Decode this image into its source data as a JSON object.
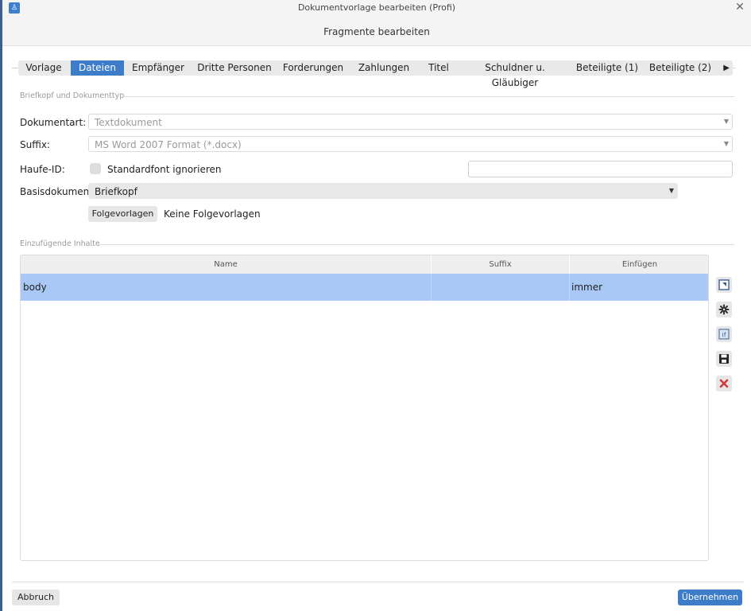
{
  "window": {
    "title": "Dokumentvorlage bearbeiten (Profi)",
    "subtitle": "Fragmente bearbeiten",
    "app_icon": "app-icon",
    "close_glyph": "✕"
  },
  "tabs": {
    "items": [
      "Vorlage",
      "Dateien",
      "Empfänger",
      "Dritte Personen",
      "Forderungen",
      "Zahlungen",
      "Titel",
      "Schuldner u. Gläubiger",
      "Beteiligte (1)",
      "Beteiligte (2)"
    ],
    "active": "Dateien",
    "more_glyph": "▶"
  },
  "briefkopf": {
    "section_title": "Briefkopf und Dokumenttyp",
    "dokumentart_label": "Dokumentart:",
    "dokumentart_value": "Textdokument",
    "suffix_label": "Suffix:",
    "suffix_value": "MS Word 2007 Format (*.docx)",
    "haufe_label": "Haufe-ID:",
    "standardfont_label": "Standardfont ignorieren",
    "standardfont_checked": false,
    "haufe_value": "",
    "basis_label": "Basisdokument:",
    "basis_value": "Briefkopf",
    "folgevorlagen_button": "Folgevorlagen",
    "folgevorlagen_text": "Keine Folgevorlagen"
  },
  "inhalte": {
    "section_title": "Einzufügende Inhalte",
    "columns": [
      "Name",
      "Suffix",
      "Einfügen"
    ],
    "rows": [
      {
        "name": "body",
        "suffix": "",
        "einfuegen": "immer"
      }
    ],
    "tools": [
      "edit-icon",
      "gear-icon",
      "if-condition-icon",
      "save-icon",
      "delete-icon"
    ]
  },
  "footer": {
    "cancel_label": "Abbruch",
    "apply_label": "Übernehmen"
  },
  "colors": {
    "accent": "#3d7cc9",
    "selected_row": "#a9c8f5",
    "delete": "#d23b3b"
  }
}
